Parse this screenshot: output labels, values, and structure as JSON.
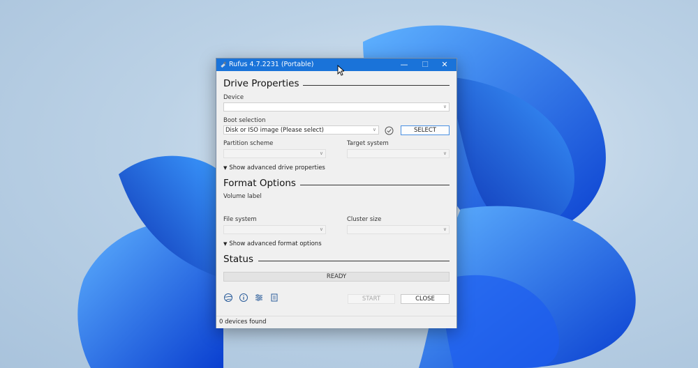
{
  "window": {
    "title": "Rufus 4.7.2231 (Portable)",
    "controls": {
      "minimize": "—",
      "maximize": "☐",
      "close": "✕"
    }
  },
  "drive_properties": {
    "heading": "Drive Properties",
    "device_label": "Device",
    "device_value": "",
    "boot_selection_label": "Boot selection",
    "boot_selection_value": "Disk or ISO image (Please select)",
    "select_button": "SELECT",
    "partition_scheme_label": "Partition scheme",
    "target_system_label": "Target system",
    "advanced_toggle": "Show advanced drive properties"
  },
  "format_options": {
    "heading": "Format Options",
    "volume_label_label": "Volume label",
    "volume_label_value": "",
    "file_system_label": "File system",
    "cluster_size_label": "Cluster size",
    "advanced_toggle": "Show advanced format options"
  },
  "status": {
    "heading": "Status",
    "text": "READY"
  },
  "actions": {
    "start": "START",
    "close": "CLOSE"
  },
  "toolbar_icons": [
    "globe-icon",
    "info-icon",
    "settings-sliders-icon",
    "log-icon"
  ],
  "footer": {
    "devices_found": "0 devices found"
  },
  "colors": {
    "titlebar": "#1a73d9",
    "window_bg": "#f0f0f0",
    "select_border": "#4a90e2"
  }
}
